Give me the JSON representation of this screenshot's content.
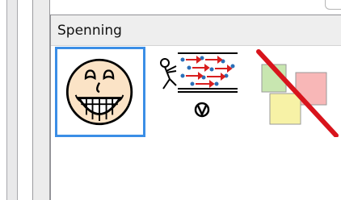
{
  "panel": {
    "title": "Spenning"
  },
  "symbols": [
    {
      "name": "grinning-face",
      "selected": true,
      "icon": "grinning-face-icon"
    },
    {
      "name": "voltage",
      "selected": false,
      "icon": "voltage-icon"
    },
    {
      "name": "crossed-notes",
      "selected": false,
      "icon": "crossed-notes-icon"
    }
  ],
  "colors": {
    "selection": "#3b8ee6",
    "panel_header": "#eeeeee",
    "strike": "#d8141c",
    "note_green": "#c8e6b0",
    "note_pink": "#f8b7b7",
    "note_yellow": "#f7f2a6",
    "face_skin": "#fbe3c6",
    "particle_red": "#d81e1e",
    "particle_blue": "#2a6fb8"
  }
}
